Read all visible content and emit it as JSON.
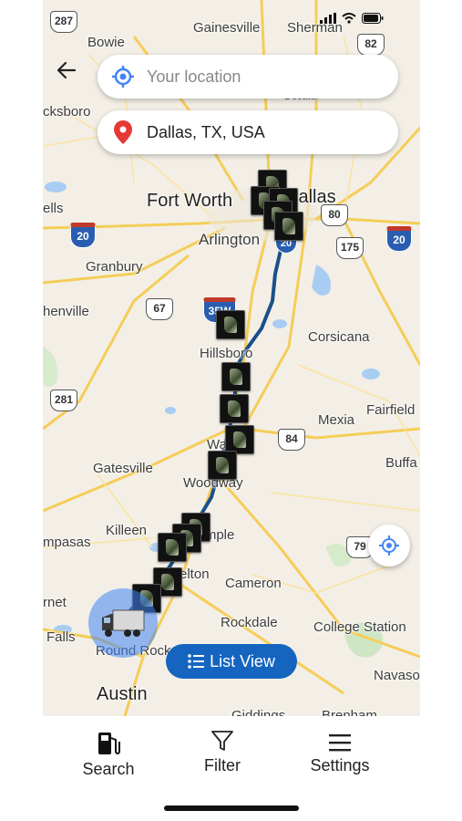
{
  "search": {
    "from_placeholder": "Your location",
    "destination": "Dallas, TX, USA"
  },
  "map": {
    "cities": [
      {
        "name": "Gainesville",
        "size": "sm"
      },
      {
        "name": "Sherman",
        "size": "sm"
      },
      {
        "name": "Bowie",
        "size": "sm"
      },
      {
        "name": "Decatur",
        "size": "sm"
      },
      {
        "name": "cksboro",
        "size": "sm"
      },
      {
        "name": "Fort Worth",
        "size": "big"
      },
      {
        "name": "Dallas",
        "size": "big"
      },
      {
        "name": "ells",
        "size": "sm"
      },
      {
        "name": "Arlington",
        "size": "med"
      },
      {
        "name": "Granbury",
        "size": "sm"
      },
      {
        "name": "henville",
        "size": "sm"
      },
      {
        "name": "Hillsboro",
        "size": "sm"
      },
      {
        "name": "Corsicana",
        "size": "sm"
      },
      {
        "name": "Mexia",
        "size": "sm"
      },
      {
        "name": "Fairfield",
        "size": "sm"
      },
      {
        "name": "Buffa",
        "size": "sm"
      },
      {
        "name": "Gatesville",
        "size": "sm"
      },
      {
        "name": "Waco",
        "size": "sm"
      },
      {
        "name": "Woodway",
        "size": "sm"
      },
      {
        "name": "Killeen",
        "size": "sm"
      },
      {
        "name": "Temple",
        "size": "sm"
      },
      {
        "name": "mpasas",
        "size": "sm"
      },
      {
        "name": "Belton",
        "size": "sm"
      },
      {
        "name": "Cameron",
        "size": "sm"
      },
      {
        "name": "rnet",
        "size": "sm"
      },
      {
        "name": "Rockdale",
        "size": "sm"
      },
      {
        "name": "College Station",
        "size": "sm"
      },
      {
        "name": "Falls",
        "size": "sm"
      },
      {
        "name": "Round Rock",
        "size": "sm"
      },
      {
        "name": "Navaso",
        "size": "sm"
      },
      {
        "name": "Austin",
        "size": "big"
      },
      {
        "name": "Giddings",
        "size": "sm"
      },
      {
        "name": "Brenham",
        "size": "sm"
      }
    ],
    "shields": [
      {
        "label": "287",
        "type": "us"
      },
      {
        "label": "82",
        "type": "us"
      },
      {
        "label": "20",
        "type": "i"
      },
      {
        "label": "80",
        "type": "us"
      },
      {
        "label": "175",
        "type": "us"
      },
      {
        "label": "20",
        "type": "i"
      },
      {
        "label": "67",
        "type": "us"
      },
      {
        "label": "35W",
        "type": "i"
      },
      {
        "label": "281",
        "type": "us"
      },
      {
        "label": "84",
        "type": "us"
      },
      {
        "label": "79",
        "type": "us"
      },
      {
        "label": "20",
        "type": "i"
      }
    ],
    "fuel_stop_count": 15,
    "route_color": "#1a4f8c"
  },
  "list_view_label": "List View",
  "tabs": [
    {
      "label": "Search",
      "icon": "fuel-pump-icon"
    },
    {
      "label": "Filter",
      "icon": "filter-icon"
    },
    {
      "label": "Settings",
      "icon": "menu-icon"
    }
  ],
  "colors": {
    "accent": "#1565c0",
    "location_blue": "#4285f4",
    "pin_red": "#e53935"
  }
}
